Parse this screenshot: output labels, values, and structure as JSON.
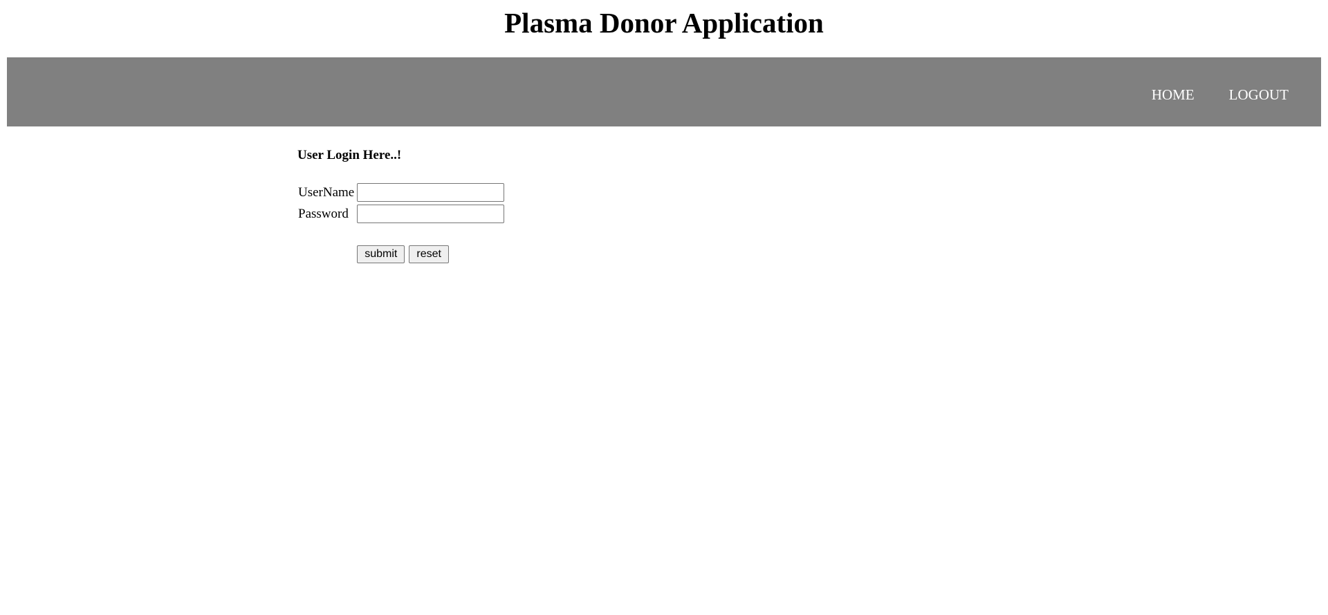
{
  "header": {
    "title": "Plasma Donor Application"
  },
  "nav": {
    "items": [
      {
        "label": "HOME"
      },
      {
        "label": "LOGOUT"
      }
    ]
  },
  "login": {
    "heading": "User Login Here..!",
    "username_label": "UserName",
    "username_value": "",
    "password_label": "Password",
    "password_value": "",
    "submit_label": "submit",
    "reset_label": "reset"
  },
  "colors": {
    "nav_background": "#808080",
    "nav_text": "#ffffff",
    "page_background": "#ffffff"
  }
}
